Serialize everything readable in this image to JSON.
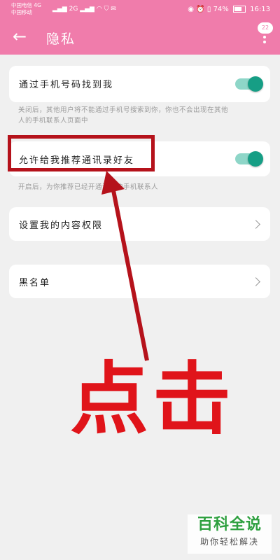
{
  "status_bar": {
    "carrier_1": "中国电信 4G",
    "carrier_2": "中国移动",
    "network_2": "2G",
    "battery": "74%",
    "time": "16:13"
  },
  "header": {
    "title": "隐私",
    "badge": "22"
  },
  "settings": {
    "find_by_phone": {
      "label": "通过手机号码找到我",
      "desc_line1": "关闭后，其他用户将不能通过手机号搜索到你，你也不会出现在其他",
      "desc_line2": "人的手机联系人页面中",
      "enabled": true
    },
    "recommend_contacts": {
      "label": "允许给我推荐通讯录好友",
      "desc": "开启后，为你推荐已经开通淘宝的手机联系人",
      "enabled": true
    },
    "content_permission": {
      "label": "设置我的内容权限"
    },
    "blacklist": {
      "label": "黑名单"
    }
  },
  "annotation": {
    "text": "点击",
    "color": "#e0141a"
  },
  "watermark": {
    "title": "百科全说",
    "subtitle": "助你轻松解决"
  },
  "colors": {
    "brand": "#f07cab",
    "toggle_on": "#169e85"
  }
}
